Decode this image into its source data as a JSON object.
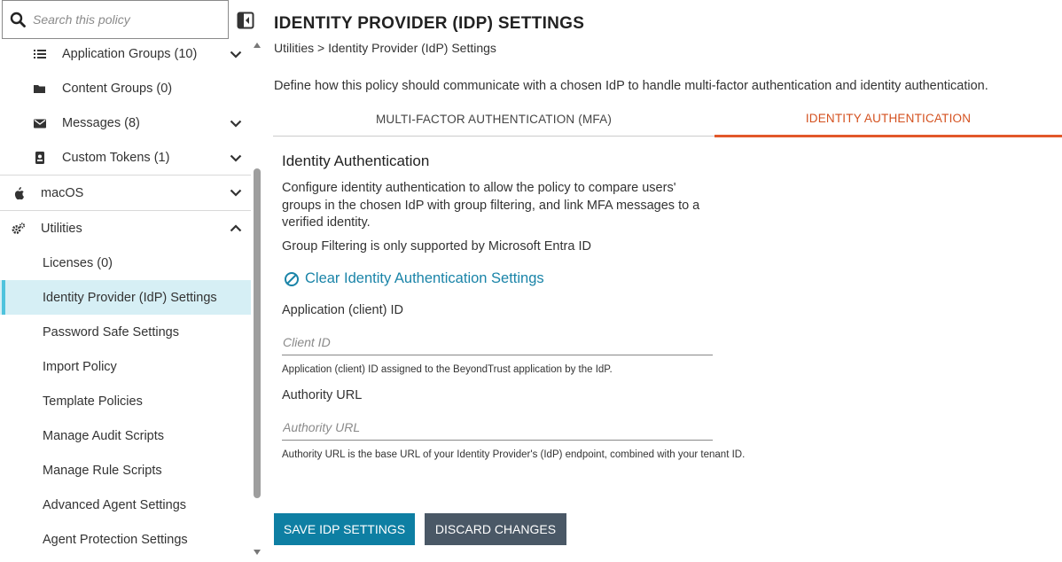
{
  "search": {
    "placeholder": "Search this policy"
  },
  "sidebar": {
    "items": [
      {
        "label": "Application Groups (10)",
        "icon": "list-icon"
      },
      {
        "label": "Content Groups (0)",
        "icon": "folder-icon"
      },
      {
        "label": "Messages (8)",
        "icon": "envelope-icon"
      },
      {
        "label": "Custom Tokens (1)",
        "icon": "id-badge-icon"
      },
      {
        "label": "macOS",
        "icon": "apple-icon"
      },
      {
        "label": "Utilities",
        "icon": "gears-icon"
      },
      {
        "label": "Licenses (0)"
      },
      {
        "label": "Identity Provider (IdP) Settings"
      },
      {
        "label": "Password Safe Settings"
      },
      {
        "label": "Import Policy"
      },
      {
        "label": "Template Policies"
      },
      {
        "label": "Manage Audit Scripts"
      },
      {
        "label": "Manage Rule Scripts"
      },
      {
        "label": "Advanced Agent Settings"
      },
      {
        "label": "Agent Protection Settings"
      }
    ]
  },
  "header": {
    "title": "IDENTITY PROVIDER (IDP) SETTINGS",
    "breadcrumb": "Utilities > Identity Provider (IdP) Settings",
    "description": "Define how this policy should communicate with a chosen IdP to handle multi-factor authentication and identity authentication."
  },
  "tabs": [
    {
      "label": "MULTI-FACTOR AUTHENTICATION (MFA)",
      "active": false
    },
    {
      "label": "IDENTITY AUTHENTICATION",
      "active": true
    }
  ],
  "section": {
    "title": "Identity Authentication",
    "description": "Configure identity authentication to allow the policy to compare users' groups in the chosen IdP with group filtering, and link MFA messages to a verified identity.",
    "group_note": "Group Filtering is only supported by Microsoft Entra ID",
    "clear_link": "Clear Identity Authentication Settings"
  },
  "fields": {
    "client_id": {
      "label": "Application (client) ID",
      "placeholder": "Client ID",
      "value": "",
      "help": "Application (client) ID assigned to the BeyondTrust application by the IdP."
    },
    "authority_url": {
      "label": "Authority URL",
      "placeholder": "Authority URL",
      "value": "",
      "help": "Authority URL is the base URL of your Identity Provider's (IdP) endpoint, combined with your tenant ID."
    }
  },
  "buttons": {
    "save": "SAVE IDP SETTINGS",
    "discard": "DISCARD CHANGES"
  },
  "colors": {
    "accent": "#0e7fa3",
    "active_tab": "#e2582a",
    "link": "#1a84a8",
    "active_nav_bg": "#d6eff5",
    "discard_bg": "#4a5866"
  }
}
